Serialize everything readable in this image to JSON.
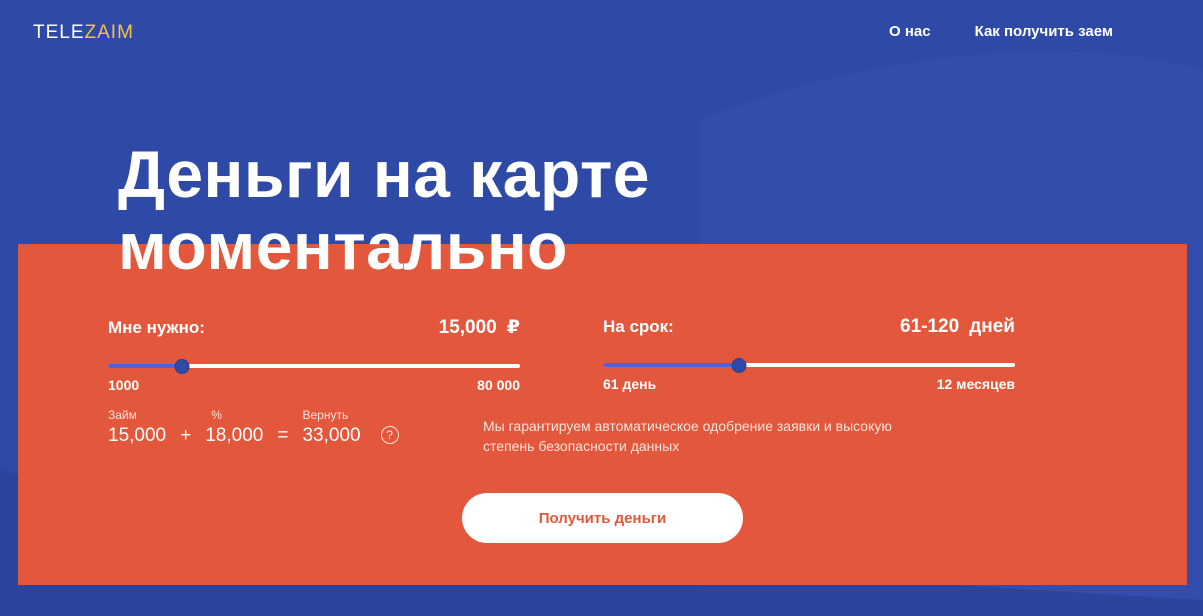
{
  "header": {
    "logo_part1": "TELE",
    "logo_part2": "ZAIM",
    "nav": [
      {
        "label": "О нас"
      },
      {
        "label": "Как получить заем"
      }
    ]
  },
  "hero": {
    "title_line1": "Деньги на карте",
    "title_line2": "моментально"
  },
  "calculator": {
    "amount": {
      "label": "Мне нужно:",
      "value": "15,000",
      "unit": "₽",
      "min_label": "1000",
      "max_label": "80 000",
      "position_fraction": 0.18
    },
    "term": {
      "label": "На срок:",
      "value": "61-120",
      "unit": "дней",
      "min_label": "61 день",
      "max_label": "12 месяцев",
      "position_fraction": 0.33
    },
    "summary": {
      "loan_caption": "Займ",
      "loan_value": "15,000",
      "plus": "+",
      "percent_caption": "%",
      "percent_value": "18,000",
      "equals": "=",
      "return_caption": "Вернуть",
      "return_value": "33,000",
      "help_symbol": "?"
    },
    "guarantee_text": "Мы гарантируем автоматическое одобрение заявки и высокую степень безопасности данных",
    "cta_label": "Получить деньги"
  },
  "colors": {
    "background": "#2f4aa6",
    "panel": "#e3573c",
    "slider_fill": "#5a5fd0",
    "logo_accent": "#f2c14e"
  }
}
